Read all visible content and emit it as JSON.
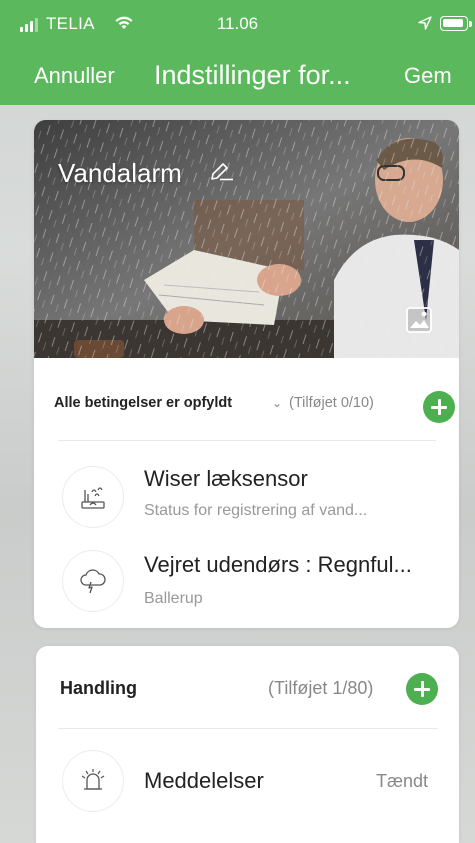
{
  "status_bar": {
    "carrier": "TELIA",
    "time": "11.06"
  },
  "nav": {
    "cancel_label": "Annuller",
    "title": "Indstillinger for...",
    "save_label": "Gem"
  },
  "scene": {
    "name": "Vandalarm"
  },
  "conditions": {
    "mode_label": "Alle betingelser er opfyldt",
    "count_label": "(Tilføjet 0/10)",
    "items": [
      {
        "title": "Wiser læksensor",
        "subtitle": "Status for registrering af vand...",
        "icon": "water-leak-sensor-icon"
      },
      {
        "title": "Vejret udendørs : Regnful...",
        "subtitle": "Ballerup",
        "icon": "rain-cloud-icon"
      }
    ]
  },
  "actions": {
    "label": "Handling",
    "count_label": "(Tilføjet 1/80)",
    "items": [
      {
        "title": "Meddelelser",
        "value": "Tændt",
        "icon": "alarm-bell-icon"
      }
    ]
  },
  "colors": {
    "header_green": "#5cb85c",
    "add_button_green": "#4caf50"
  }
}
